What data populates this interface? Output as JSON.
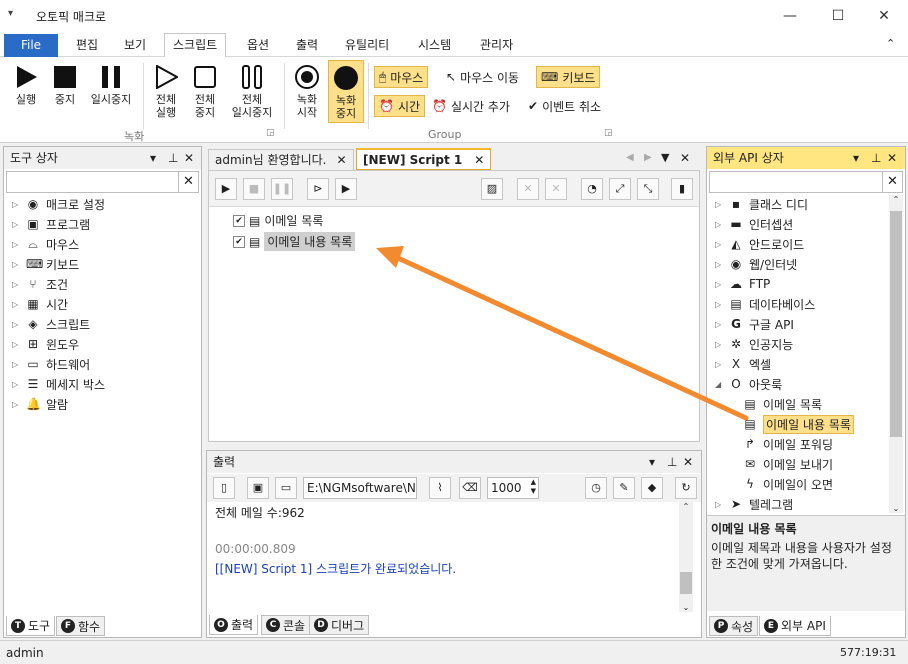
{
  "app": {
    "title": "오토픽 매크로",
    "min": "—",
    "max": "☐",
    "close": "✕",
    "collapse": "⌃"
  },
  "menu": {
    "file": "File",
    "items": [
      "편집",
      "보기",
      "스크립트",
      "옵션",
      "출력",
      "유틸리티",
      "시스템",
      "관리자"
    ],
    "active_index": 2
  },
  "ribbon": {
    "run": "실행",
    "stop": "중지",
    "pause": "일시중지",
    "all_run": "전체\n실행",
    "all_stop": "전체\n중지",
    "all_pause": "전체\n일시중지",
    "rec_start": "녹화\n시작",
    "rec_stop": "녹화\n중지",
    "group_record": "녹화",
    "group_group": "Group",
    "mouse": "마우스",
    "mouse_move": "마우스 이동",
    "keyboard": "키보드",
    "time": "시간",
    "realtime_add": "실시간 추가",
    "event_cancel": "이벤트 취소"
  },
  "tools_panel": {
    "title": "도구 상자",
    "search_placeholder": "",
    "items": [
      "매크로 설정",
      "프로그램",
      "마우스",
      "키보드",
      "조건",
      "시간",
      "스크립트",
      "윈도우",
      "하드웨어",
      "메세지 박스",
      "알람"
    ],
    "tab_tools": "도구",
    "tab_tools_letter": "T",
    "tab_funcs": "함수",
    "tab_funcs_letter": "F"
  },
  "doc_tabs": {
    "welcome": "admin님 환영합니다.",
    "script": "[NEW] Script 1"
  },
  "script": {
    "items": [
      {
        "label": "이메일 목록",
        "checked": true
      },
      {
        "label": "이메일 내용 목록",
        "checked": true
      }
    ]
  },
  "output": {
    "title": "출력",
    "path": "E:\\NGMsoftware\\NG",
    "count": "1000",
    "lines": [
      "전체 메일 수:962",
      "",
      "00:00:00.809",
      "[[NEW] Script 1] 스크립트가 완료되었습니다."
    ],
    "tab_output": "출력",
    "tab_output_letter": "O",
    "tab_console": "콘솔",
    "tab_console_letter": "C",
    "tab_debug": "디버그",
    "tab_debug_letter": "D"
  },
  "api_panel": {
    "title": "외부 API 상자",
    "items": [
      "클래스 디디",
      "인터셉션",
      "안드로이드",
      "웹/인터넷",
      "FTP",
      "데이타베이스",
      "구글 API",
      "인공지능",
      "엑셀",
      "아웃룩"
    ],
    "outlook_children": [
      "이메일 목록",
      "이메일 내용 목록",
      "이메일 포워딩",
      "이메일 보내기",
      "이메일이 오면"
    ],
    "last": "텔레그램",
    "desc_title": "이메일 내용 목록",
    "desc_text": "이메일 제목과 내용을 사용자가 설정한 조건에 맞게 가져옵니다.",
    "tab_props": "속성",
    "tab_props_letter": "P",
    "tab_api": "외부 API",
    "tab_api_letter": "E"
  },
  "status": {
    "user": "admin",
    "time": "577:19:31"
  },
  "colors": {
    "accent": "#2b6bc8",
    "highlight": "#ffe08a",
    "arrow": "#f28a30",
    "panel_head_active": "#ffe680",
    "output_link": "#1a3fb8"
  }
}
